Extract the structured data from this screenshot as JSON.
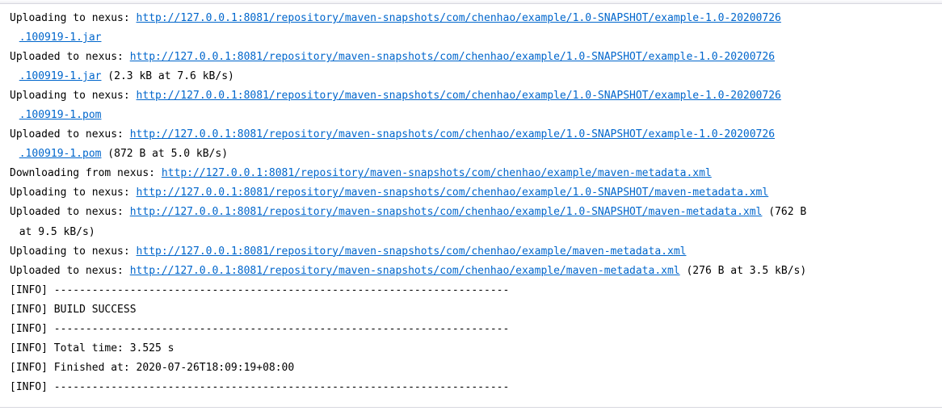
{
  "log": {
    "lines": [
      {
        "prefix": "Uploading to nexus: ",
        "url": "http://127.0.0.1:8081/repository/maven-snapshots/com/chenhao/example/1.0-SNAPSHOT/example-1.0-20200726",
        "urlWrap": ".100919-1.jar",
        "suffix": ""
      },
      {
        "prefix": "Uploaded to nexus: ",
        "url": "http://127.0.0.1:8081/repository/maven-snapshots/com/chenhao/example/1.0-SNAPSHOT/example-1.0-20200726",
        "urlWrap": ".100919-1.jar",
        "suffix": " (2.3 kB at 7.6 kB/s)"
      },
      {
        "prefix": "Uploading to nexus: ",
        "url": "http://127.0.0.1:8081/repository/maven-snapshots/com/chenhao/example/1.0-SNAPSHOT/example-1.0-20200726",
        "urlWrap": ".100919-1.pom",
        "suffix": ""
      },
      {
        "prefix": "Uploaded to nexus: ",
        "url": "http://127.0.0.1:8081/repository/maven-snapshots/com/chenhao/example/1.0-SNAPSHOT/example-1.0-20200726",
        "urlWrap": ".100919-1.pom",
        "suffix": " (872 B at 5.0 kB/s)"
      },
      {
        "prefix": "Downloading from nexus: ",
        "url": "http://127.0.0.1:8081/repository/maven-snapshots/com/chenhao/example/maven-metadata.xml",
        "suffix": ""
      },
      {
        "prefix": "Uploading to nexus: ",
        "url": "http://127.0.0.1:8081/repository/maven-snapshots/com/chenhao/example/1.0-SNAPSHOT/maven-metadata.xml",
        "suffix": ""
      },
      {
        "prefix": "Uploaded to nexus: ",
        "url": "http://127.0.0.1:8081/repository/maven-snapshots/com/chenhao/example/1.0-SNAPSHOT/maven-metadata.xml",
        "suffix": " (762 B",
        "suffixWrap": " at 9.5 kB/s)"
      },
      {
        "prefix": "Uploading to nexus: ",
        "url": "http://127.0.0.1:8081/repository/maven-snapshots/com/chenhao/example/maven-metadata.xml",
        "suffix": ""
      },
      {
        "prefix": "Uploaded to nexus: ",
        "url": "http://127.0.0.1:8081/repository/maven-snapshots/com/chenhao/example/maven-metadata.xml",
        "suffix": " (276 B at 3.5 kB/s)"
      },
      {
        "plain": "[INFO] ------------------------------------------------------------------------"
      },
      {
        "plain": "[INFO] BUILD SUCCESS"
      },
      {
        "plain": "[INFO] ------------------------------------------------------------------------"
      },
      {
        "plain": "[INFO] Total time:  3.525 s"
      },
      {
        "plain": "[INFO] Finished at: 2020-07-26T18:09:19+08:00"
      },
      {
        "plain": "[INFO] ------------------------------------------------------------------------"
      }
    ]
  }
}
